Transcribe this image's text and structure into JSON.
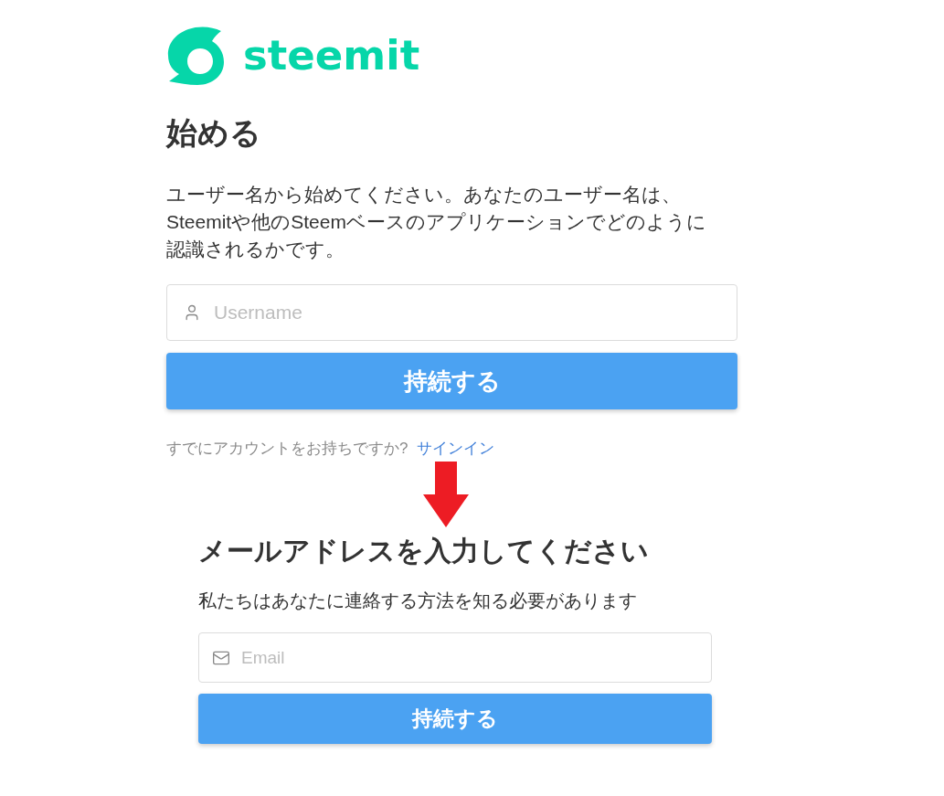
{
  "logo": {
    "wordmark": "steemit"
  },
  "signup": {
    "title": "始める",
    "description": "ユーザー名から始めてください。あなたのユーザー名は、Steemitや他のSteemベースのアプリケーションでどのように認識されるかです。",
    "username_field": {
      "placeholder": "Username"
    },
    "button": "持続する",
    "signin_prompt": {
      "text": "すでにアカウントをお持ちですか?",
      "link": "サインイン"
    }
  },
  "email_step": {
    "title": "メールアドレスを入力してください",
    "description": "私たちはあなたに連絡する方法を知る必要があります",
    "email_field": {
      "placeholder": "Email"
    },
    "button": "持続する"
  }
}
